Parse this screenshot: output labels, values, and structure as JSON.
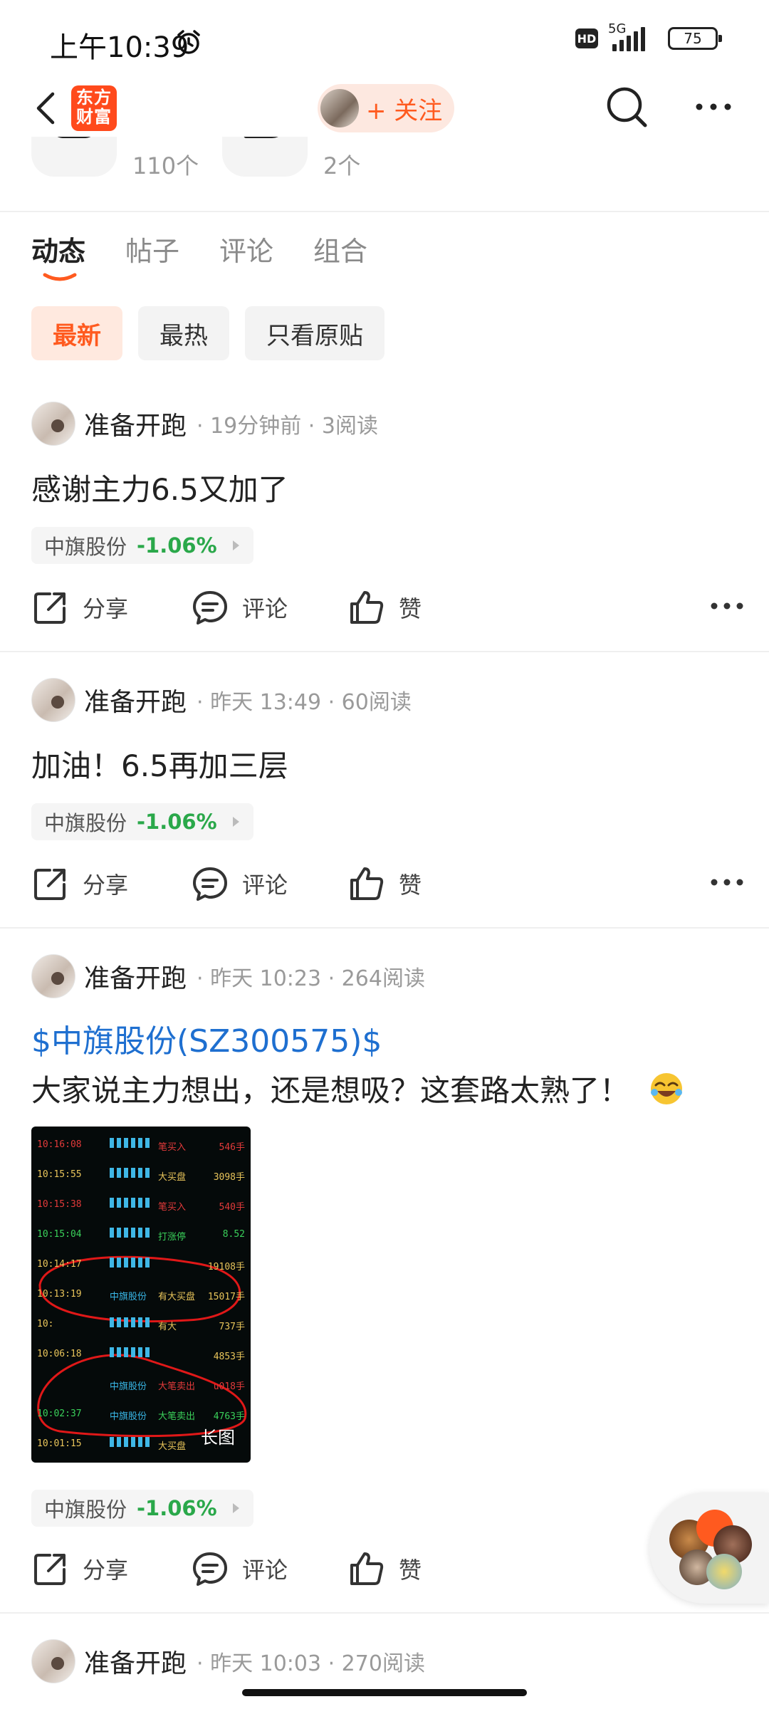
{
  "status_bar": {
    "time": "上午10:39",
    "network": "5G",
    "hd": "HD",
    "battery": "75"
  },
  "nav": {
    "logo_line1": "东方",
    "logo_line2": "财富",
    "follow_label": "+ 关注"
  },
  "stats": [
    {
      "count": "110个"
    },
    {
      "count": "2个"
    }
  ],
  "tabs": [
    {
      "label": "动态",
      "active": true
    },
    {
      "label": "帖子",
      "active": false
    },
    {
      "label": "评论",
      "active": false
    },
    {
      "label": "组合",
      "active": false
    }
  ],
  "filters": [
    {
      "label": "最新",
      "active": true
    },
    {
      "label": "最热",
      "active": false
    },
    {
      "label": "只看原贴",
      "active": false
    }
  ],
  "actions": {
    "share": "分享",
    "comment": "评论",
    "like": "赞"
  },
  "posts": [
    {
      "author": "准备开跑",
      "meta": "· 19分钟前 · 3阅读",
      "text": "感谢主力6.5又加了",
      "stock": {
        "name": "中旗股份",
        "change": "-1.06%"
      }
    },
    {
      "author": "准备开跑",
      "meta": "· 昨天 13:49 · 60阅读",
      "text": "加油！6.5再加三层",
      "stock": {
        "name": "中旗股份",
        "change": "-1.06%"
      }
    },
    {
      "author": "准备开跑",
      "meta": "· 昨天 10:23 · 264阅读",
      "link": "$中旗股份(SZ300575)$",
      "text": "大家说主力想出，还是想吸？这套路太熟了！",
      "image_badge": "长图",
      "stock": {
        "name": "中旗股份",
        "change": "-1.06%"
      }
    },
    {
      "author": "准备开跑",
      "meta": "· 昨天 10:03 · 270阅读"
    }
  ],
  "thumbnail_rows": [
    {
      "time": "10:16:08",
      "kind": "笔买入",
      "vol": "546手",
      "color": "#e23a3a"
    },
    {
      "time": "10:15:55",
      "kind": "大买盘",
      "vol": "3098手",
      "color": "#e8c45a"
    },
    {
      "time": "10:15:38",
      "kind": "笔买入",
      "vol": "540手",
      "color": "#e23a3a"
    },
    {
      "time": "10:15:04",
      "kind": "打涨停",
      "vol": "8.52",
      "color": "#3ad05a"
    },
    {
      "time": "10:14:17",
      "kind": "",
      "vol": "19108手",
      "color": "#e8c45a"
    },
    {
      "time": "10:13:19",
      "name": "中旗股份",
      "kind": "有大买盘",
      "vol": "15017手",
      "color": "#e8c45a"
    },
    {
      "time": "10:",
      "kind": "有大",
      "vol": "737手",
      "color": "#e8c45a"
    },
    {
      "time": "10:06:18",
      "kind": "",
      "vol": "4853手",
      "color": "#e8c45a"
    },
    {
      "time": "",
      "name": "中旗股份",
      "kind": "大笔卖出",
      "vol": "u018手",
      "color": "#e23a3a"
    },
    {
      "time": "10:02:37",
      "name": "中旗股份",
      "kind": "大笔卖出",
      "vol": "4763手",
      "color": "#3ad05a"
    },
    {
      "time": "10:01:15",
      "kind": "大买盘",
      "vol": "",
      "color": "#e8c45a"
    }
  ]
}
